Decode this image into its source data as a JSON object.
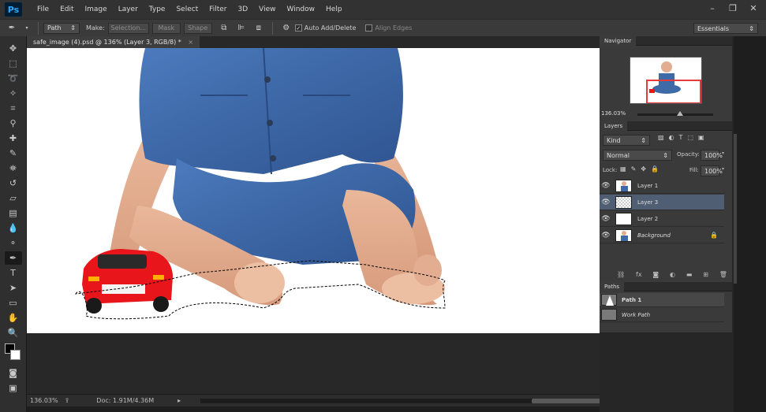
{
  "app": {
    "logo": "Ps"
  },
  "menu": [
    "File",
    "Edit",
    "Image",
    "Layer",
    "Type",
    "Select",
    "Filter",
    "3D",
    "View",
    "Window",
    "Help"
  ],
  "window_controls": {
    "minimize": "–",
    "restore": "❐",
    "close": "✕"
  },
  "options_bar": {
    "tool_mode": "Path",
    "make_label": "Make:",
    "selection_button": "Selection...",
    "mask_button": "Mask",
    "shape_button": "Shape",
    "auto_add_delete_label": "Auto Add/Delete",
    "auto_add_delete_checked": true,
    "align_edges_label": "Align Edges",
    "align_edges_checked": false,
    "workspace": "Essentials"
  },
  "document": {
    "tab_title": "safe_image (4).psd @ 136% (Layer 3, RGB/8) *",
    "close": "×"
  },
  "status_bar": {
    "zoom": "136.03%",
    "doc_info": "Doc: 1.91M/4.36M"
  },
  "navigator": {
    "tab": "Navigator",
    "zoom": "136.03%"
  },
  "layers": {
    "tab": "Layers",
    "filter_kind": "Kind",
    "blend_mode": "Normal",
    "opacity_label": "Opacity:",
    "opacity": "100%",
    "lock_label": "Lock:",
    "fill_label": "Fill:",
    "fill": "100%",
    "items": [
      {
        "name": "Layer 1",
        "selected": false,
        "thumb": "figure"
      },
      {
        "name": "Layer 3",
        "selected": true,
        "thumb": "transparent"
      },
      {
        "name": "Layer 2",
        "selected": false,
        "thumb": "white"
      },
      {
        "name": "Background",
        "selected": false,
        "thumb": "figure",
        "locked": true
      }
    ]
  },
  "paths": {
    "tab": "Paths",
    "items": [
      {
        "name": "Path 1",
        "selected": true
      },
      {
        "name": "Work Path",
        "selected": false
      }
    ]
  },
  "colors": {
    "accent_selection": "#4f5e72",
    "navigator_view": "#e53b3b",
    "toy_car": "#e8151b",
    "denim": "#3f6aa8"
  }
}
